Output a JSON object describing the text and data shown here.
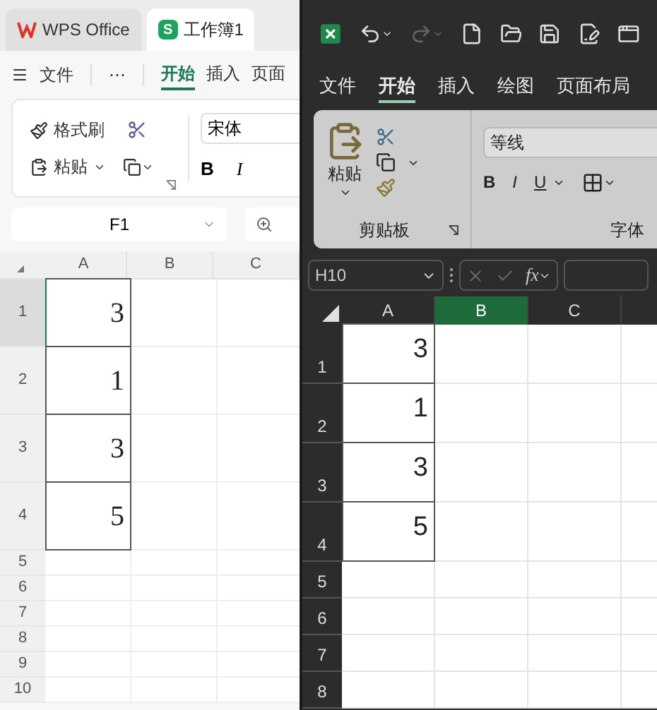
{
  "wps": {
    "tabs": [
      {
        "kind": "home",
        "label": "WPS Office",
        "selected": false
      },
      {
        "kind": "document",
        "badge": "S",
        "label": "工作簿1",
        "selected": true
      }
    ],
    "file_menu": "文件",
    "more": "⋯",
    "ribbon_tabs": [
      {
        "label": "开始",
        "selected": true
      },
      {
        "label": "插入",
        "selected": false
      },
      {
        "label": "页面",
        "selected": false
      }
    ],
    "ribbon": {
      "format_painter": "格式刷",
      "paste": "粘贴",
      "font": "宋体",
      "bold": "B",
      "italic": "I"
    },
    "name_box": "F1",
    "columns": [
      {
        "label": "A",
        "selected": false
      },
      {
        "label": "B",
        "selected": false
      },
      {
        "label": "C",
        "selected": false
      }
    ],
    "rows": [
      {
        "header": "1",
        "value": "3",
        "selected": true
      },
      {
        "header": "2",
        "value": "1",
        "selected": false
      },
      {
        "header": "3",
        "value": "3",
        "selected": false
      },
      {
        "header": "4",
        "value": "5",
        "selected": false
      },
      {
        "header": "5",
        "selected": false
      },
      {
        "header": "6",
        "selected": false
      },
      {
        "header": "7",
        "selected": false
      },
      {
        "header": "8",
        "selected": false
      },
      {
        "header": "9",
        "selected": false
      },
      {
        "header": "10",
        "selected": false
      }
    ]
  },
  "excel": {
    "ribbon_tabs": [
      {
        "label": "文件",
        "selected": false
      },
      {
        "label": "开始",
        "selected": true
      },
      {
        "label": "插入",
        "selected": false
      },
      {
        "label": "绘图",
        "selected": false
      },
      {
        "label": "页面布局",
        "selected": false
      }
    ],
    "ribbon": {
      "paste": "粘贴",
      "clipboard_group": "剪贴板",
      "font": "等线",
      "bold": "B",
      "italic": "I",
      "underline": "U",
      "font_group": "字体"
    },
    "name_box": "H10",
    "fx": "fx",
    "columns": [
      {
        "label": "A",
        "selected": false
      },
      {
        "label": "B",
        "selected": true
      },
      {
        "label": "C",
        "selected": false
      }
    ],
    "rows": [
      {
        "header": "1",
        "value": "3"
      },
      {
        "header": "2",
        "value": "1"
      },
      {
        "header": "3",
        "value": "3"
      },
      {
        "header": "4",
        "value": "5"
      },
      {
        "header": "5"
      },
      {
        "header": "6"
      },
      {
        "header": "7"
      },
      {
        "header": "8"
      }
    ]
  }
}
